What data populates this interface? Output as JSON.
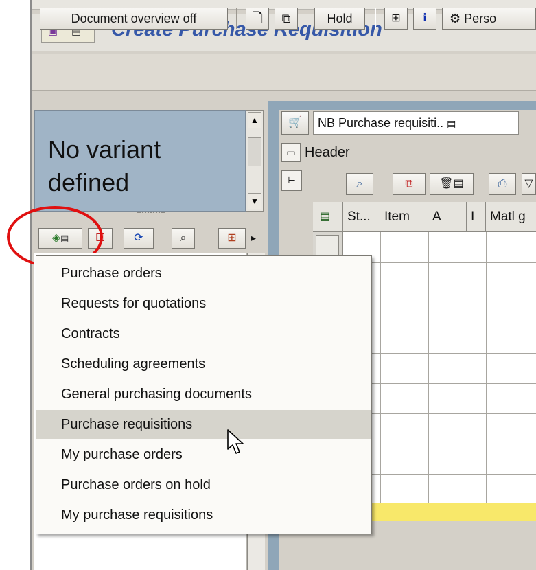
{
  "title": "Create Purchase Requisition",
  "toolbar": {
    "document_overview": "Document overview off",
    "hold": "Hold",
    "personal": "Perso"
  },
  "left_pane": {
    "variant_text": "No variant defined"
  },
  "menu": {
    "items": [
      {
        "label": "Purchase orders"
      },
      {
        "label": "Requests for quotations"
      },
      {
        "label": "Contracts"
      },
      {
        "label": "Scheduling agreements"
      },
      {
        "label": "General purchasing documents"
      },
      {
        "label": "Purchase requisitions"
      },
      {
        "label": "My purchase orders"
      },
      {
        "label": "Purchase orders on hold"
      },
      {
        "label": "My purchase requisitions"
      }
    ],
    "selected_index": 5
  },
  "document": {
    "type_value": "NB Purchase requisiti..",
    "header_label": "Header"
  },
  "grid": {
    "columns": [
      "St...",
      "Item",
      "A",
      "I",
      "Matl g"
    ]
  },
  "colors": {
    "title": "#3658a8",
    "variant_bg": "#a0b4c6",
    "highlight": "#e01010",
    "yellow_bar": "#f8e86a"
  }
}
